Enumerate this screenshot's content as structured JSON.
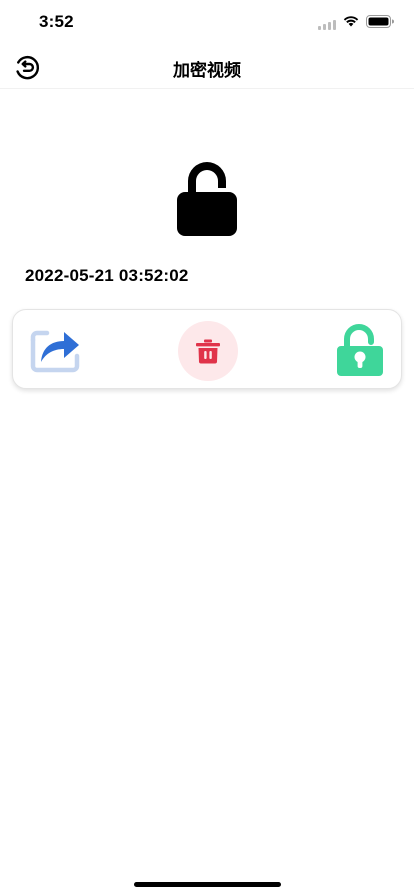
{
  "status_bar": {
    "time": "3:52"
  },
  "nav": {
    "title": "加密视频",
    "back_icon": "back-arrow-circle-icon"
  },
  "media": {
    "lock_icon": "lock-icon",
    "timestamp": "2022-05-21 03:52:02"
  },
  "actions": [
    {
      "name": "share",
      "icon": "share-icon",
      "color": "#2f6fd6"
    },
    {
      "name": "delete",
      "icon": "trash-icon",
      "color": "#e0334a"
    },
    {
      "name": "unlock",
      "icon": "unlock-icon",
      "color": "#3fd69a"
    }
  ],
  "colors": {
    "share_blue": "#2f6fd6",
    "delete_red": "#e0334a",
    "delete_bg": "#fde8ea",
    "unlock_green": "#3fd69a"
  }
}
